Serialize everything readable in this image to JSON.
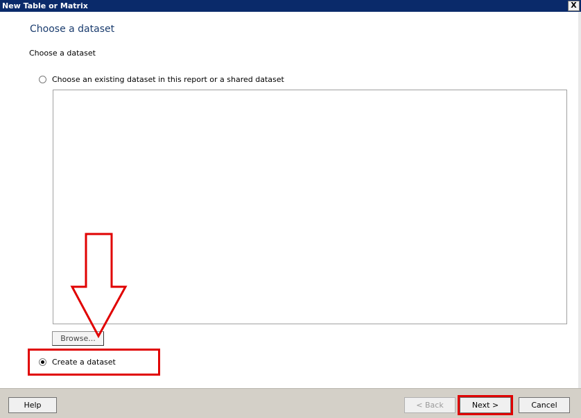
{
  "window": {
    "title": "New Table or Matrix",
    "close_glyph": "X"
  },
  "page": {
    "title": "Choose a dataset",
    "section_label": "Choose a dataset"
  },
  "options": {
    "existing_label": "Choose an existing dataset in this report or a shared dataset",
    "existing_selected": false,
    "browse_label": "Browse...",
    "create_label": "Create a dataset",
    "create_selected": true
  },
  "annotations": {
    "highlight_color": "#e00000",
    "arrow_color": "#e00000"
  },
  "footer": {
    "help_label": "Help",
    "back_label": "< Back",
    "back_enabled": false,
    "next_label": "Next >",
    "cancel_label": "Cancel"
  }
}
